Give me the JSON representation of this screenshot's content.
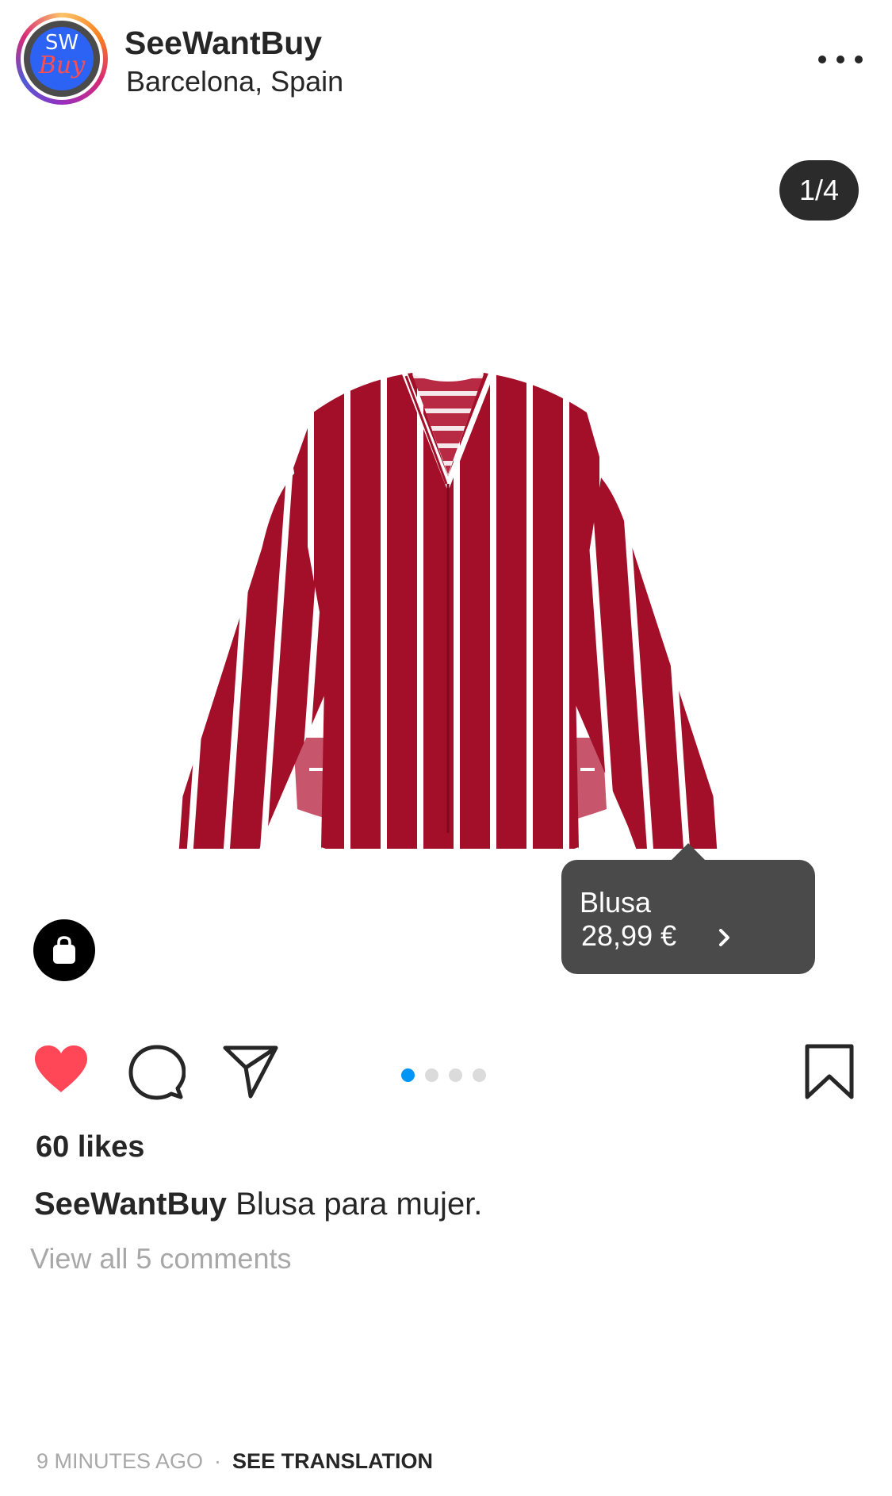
{
  "header": {
    "avatar_line1": "SW",
    "avatar_line2": "Buy",
    "username": "SeeWantBuy",
    "location": "Barcelona, Spain",
    "more_icon": "more-horizontal-icon"
  },
  "media": {
    "counter": "1/4",
    "image_subject": "red and white striped long-sleeve blouse",
    "shop_icon": "shopping-bag-icon",
    "product_tag": {
      "name": "Blusa",
      "price": "28,99 €",
      "icon": "chevron-right-icon"
    },
    "carousel": {
      "total": 4,
      "active_index": 0
    }
  },
  "actions": {
    "like_icon": "heart-icon",
    "liked": true,
    "comment_icon": "comment-icon",
    "share_icon": "send-icon",
    "save_icon": "bookmark-icon"
  },
  "post": {
    "likes": "60 likes",
    "caption_user": "SeeWantBuy",
    "caption_text": "Blusa para mujer.",
    "view_comments": "View all 5 comments",
    "timestamp": "9 MINUTES AGO",
    "separator": "·",
    "see_translation": "SEE TRANSLATION"
  },
  "colors": {
    "heart": "#ff4757",
    "active_dot": "#0095f6",
    "inactive_dot": "#dbdbdb",
    "shirt_red": "#a30f28",
    "tag_bg": "#4a4a4a",
    "secondary_text": "#a8a8a8"
  }
}
